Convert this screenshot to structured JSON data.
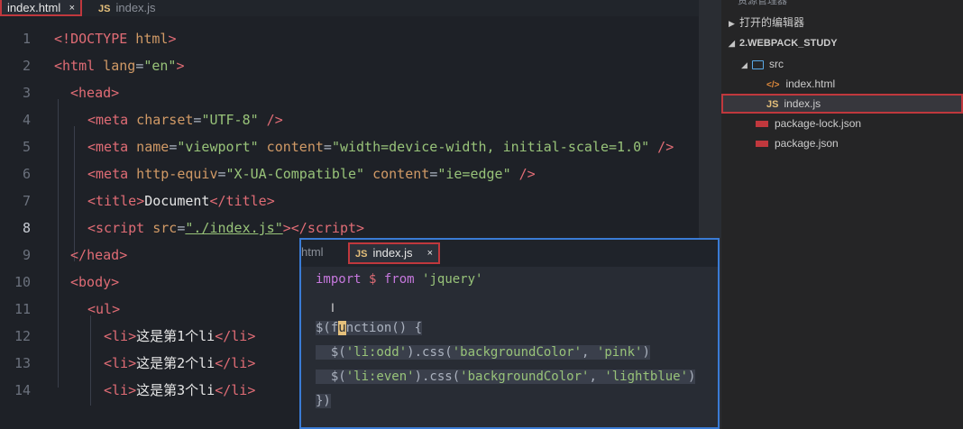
{
  "editor": {
    "tabs": [
      {
        "label": "index.html",
        "active": true,
        "close": "×"
      },
      {
        "label": "index.js",
        "icon": "js-file-icon",
        "glyph": "JS"
      }
    ],
    "line_numbers": [
      "1",
      "2",
      "3",
      "4",
      "5",
      "6",
      "7",
      "8",
      "9",
      "10",
      "11",
      "12",
      "13",
      "14"
    ],
    "lines": {
      "l1": {
        "a": "<!",
        "b": "DOCTYPE",
        "c": " html",
        "d": ">"
      },
      "l2": {
        "a": "<",
        "b": "html",
        "c": " lang",
        "d": "=",
        "e": "\"en\"",
        "f": ">"
      },
      "l3": {
        "a": "<",
        "b": "head",
        "c": ">"
      },
      "l4": {
        "a": "<",
        "b": "meta",
        "c": " charset",
        "d": "=",
        "e": "\"UTF-8\"",
        "f": " />"
      },
      "l5": {
        "a": "<",
        "b": "meta",
        "c": " name",
        "d": "=",
        "e": "\"viewport\"",
        "f": " content",
        "g": "=",
        "h": "\"width=device-width, initial-scale=1.0\"",
        "i": " />"
      },
      "l6": {
        "a": "<",
        "b": "meta",
        "c": " http-equiv",
        "d": "=",
        "e": "\"X-UA-Compatible\"",
        "f": " content",
        "g": "=",
        "h": "\"ie=edge\"",
        "i": " />"
      },
      "l7": {
        "a": "<",
        "b": "title",
        "c": ">",
        "d": "Document",
        "e": "</",
        "f": "title",
        "g": ">"
      },
      "l8": {
        "a": "<",
        "b": "script",
        "c": " src",
        "d": "=",
        "e": "\"./index.js\"",
        "f": "></",
        "g": "script",
        "h": ">"
      },
      "l9": {
        "a": "</",
        "b": "head",
        "c": ">"
      },
      "l10": {
        "a": "<",
        "b": "body",
        "c": ">"
      },
      "l11": {
        "a": "<",
        "b": "ul",
        "c": ">"
      },
      "l12": {
        "a": "<",
        "b": "li",
        "c": ">",
        "d": "这是第1个li",
        "e": "</",
        "f": "li",
        "g": ">"
      },
      "l13": {
        "a": "<",
        "b": "li",
        "c": ">",
        "d": "这是第2个li",
        "e": "</",
        "f": "li",
        "g": ">"
      },
      "l14": {
        "a": "<",
        "b": "li",
        "c": ">",
        "d": "这是第3个li",
        "e": "</",
        "f": "li",
        "g": ">"
      }
    }
  },
  "explorer": {
    "header": "资源管理器",
    "open_editors": "打开的编辑器",
    "project": "2.WEBPACK_STUDY",
    "items": [
      {
        "label": "src",
        "type": "folder"
      },
      {
        "label": "index.html",
        "type": "html",
        "icon_glyph": "</>"
      },
      {
        "label": "index.js",
        "type": "js",
        "icon_glyph": "JS",
        "selected": true
      },
      {
        "label": "package-lock.json",
        "type": "json"
      },
      {
        "label": "package.json",
        "type": "json"
      }
    ]
  },
  "peek": {
    "tab_html": "html",
    "tab_js": {
      "label": "index.js",
      "glyph": "JS",
      "close": "×"
    },
    "ibeam": "I",
    "lines": {
      "p1": {
        "a": "import",
        "b": " $ ",
        "c": "from",
        "d": " ",
        "e": "'jquery'"
      },
      "p3": {
        "a": "$(",
        "b": "f",
        "c": "u",
        "d": "nction() {"
      },
      "p4": {
        "a": "  $(",
        "b": "'li:odd'",
        "c": ").css(",
        "d": "'backgroundColor'",
        "e": ", ",
        "f": "'pink'",
        "g": ")"
      },
      "p5": {
        "a": "  $(",
        "b": "'li:even'",
        "c": ").css(",
        "d": "'backgroundColor'",
        "e": ", ",
        "f": "'lightblue'",
        "g": ")"
      },
      "p6": {
        "a": "})"
      }
    }
  },
  "colors": {
    "accent_border": "#c0383d",
    "peek_border": "#3a7bd5",
    "tag": "#e06c75",
    "attr": "#d19a66",
    "string": "#98c379",
    "keyword": "#c678dd"
  }
}
